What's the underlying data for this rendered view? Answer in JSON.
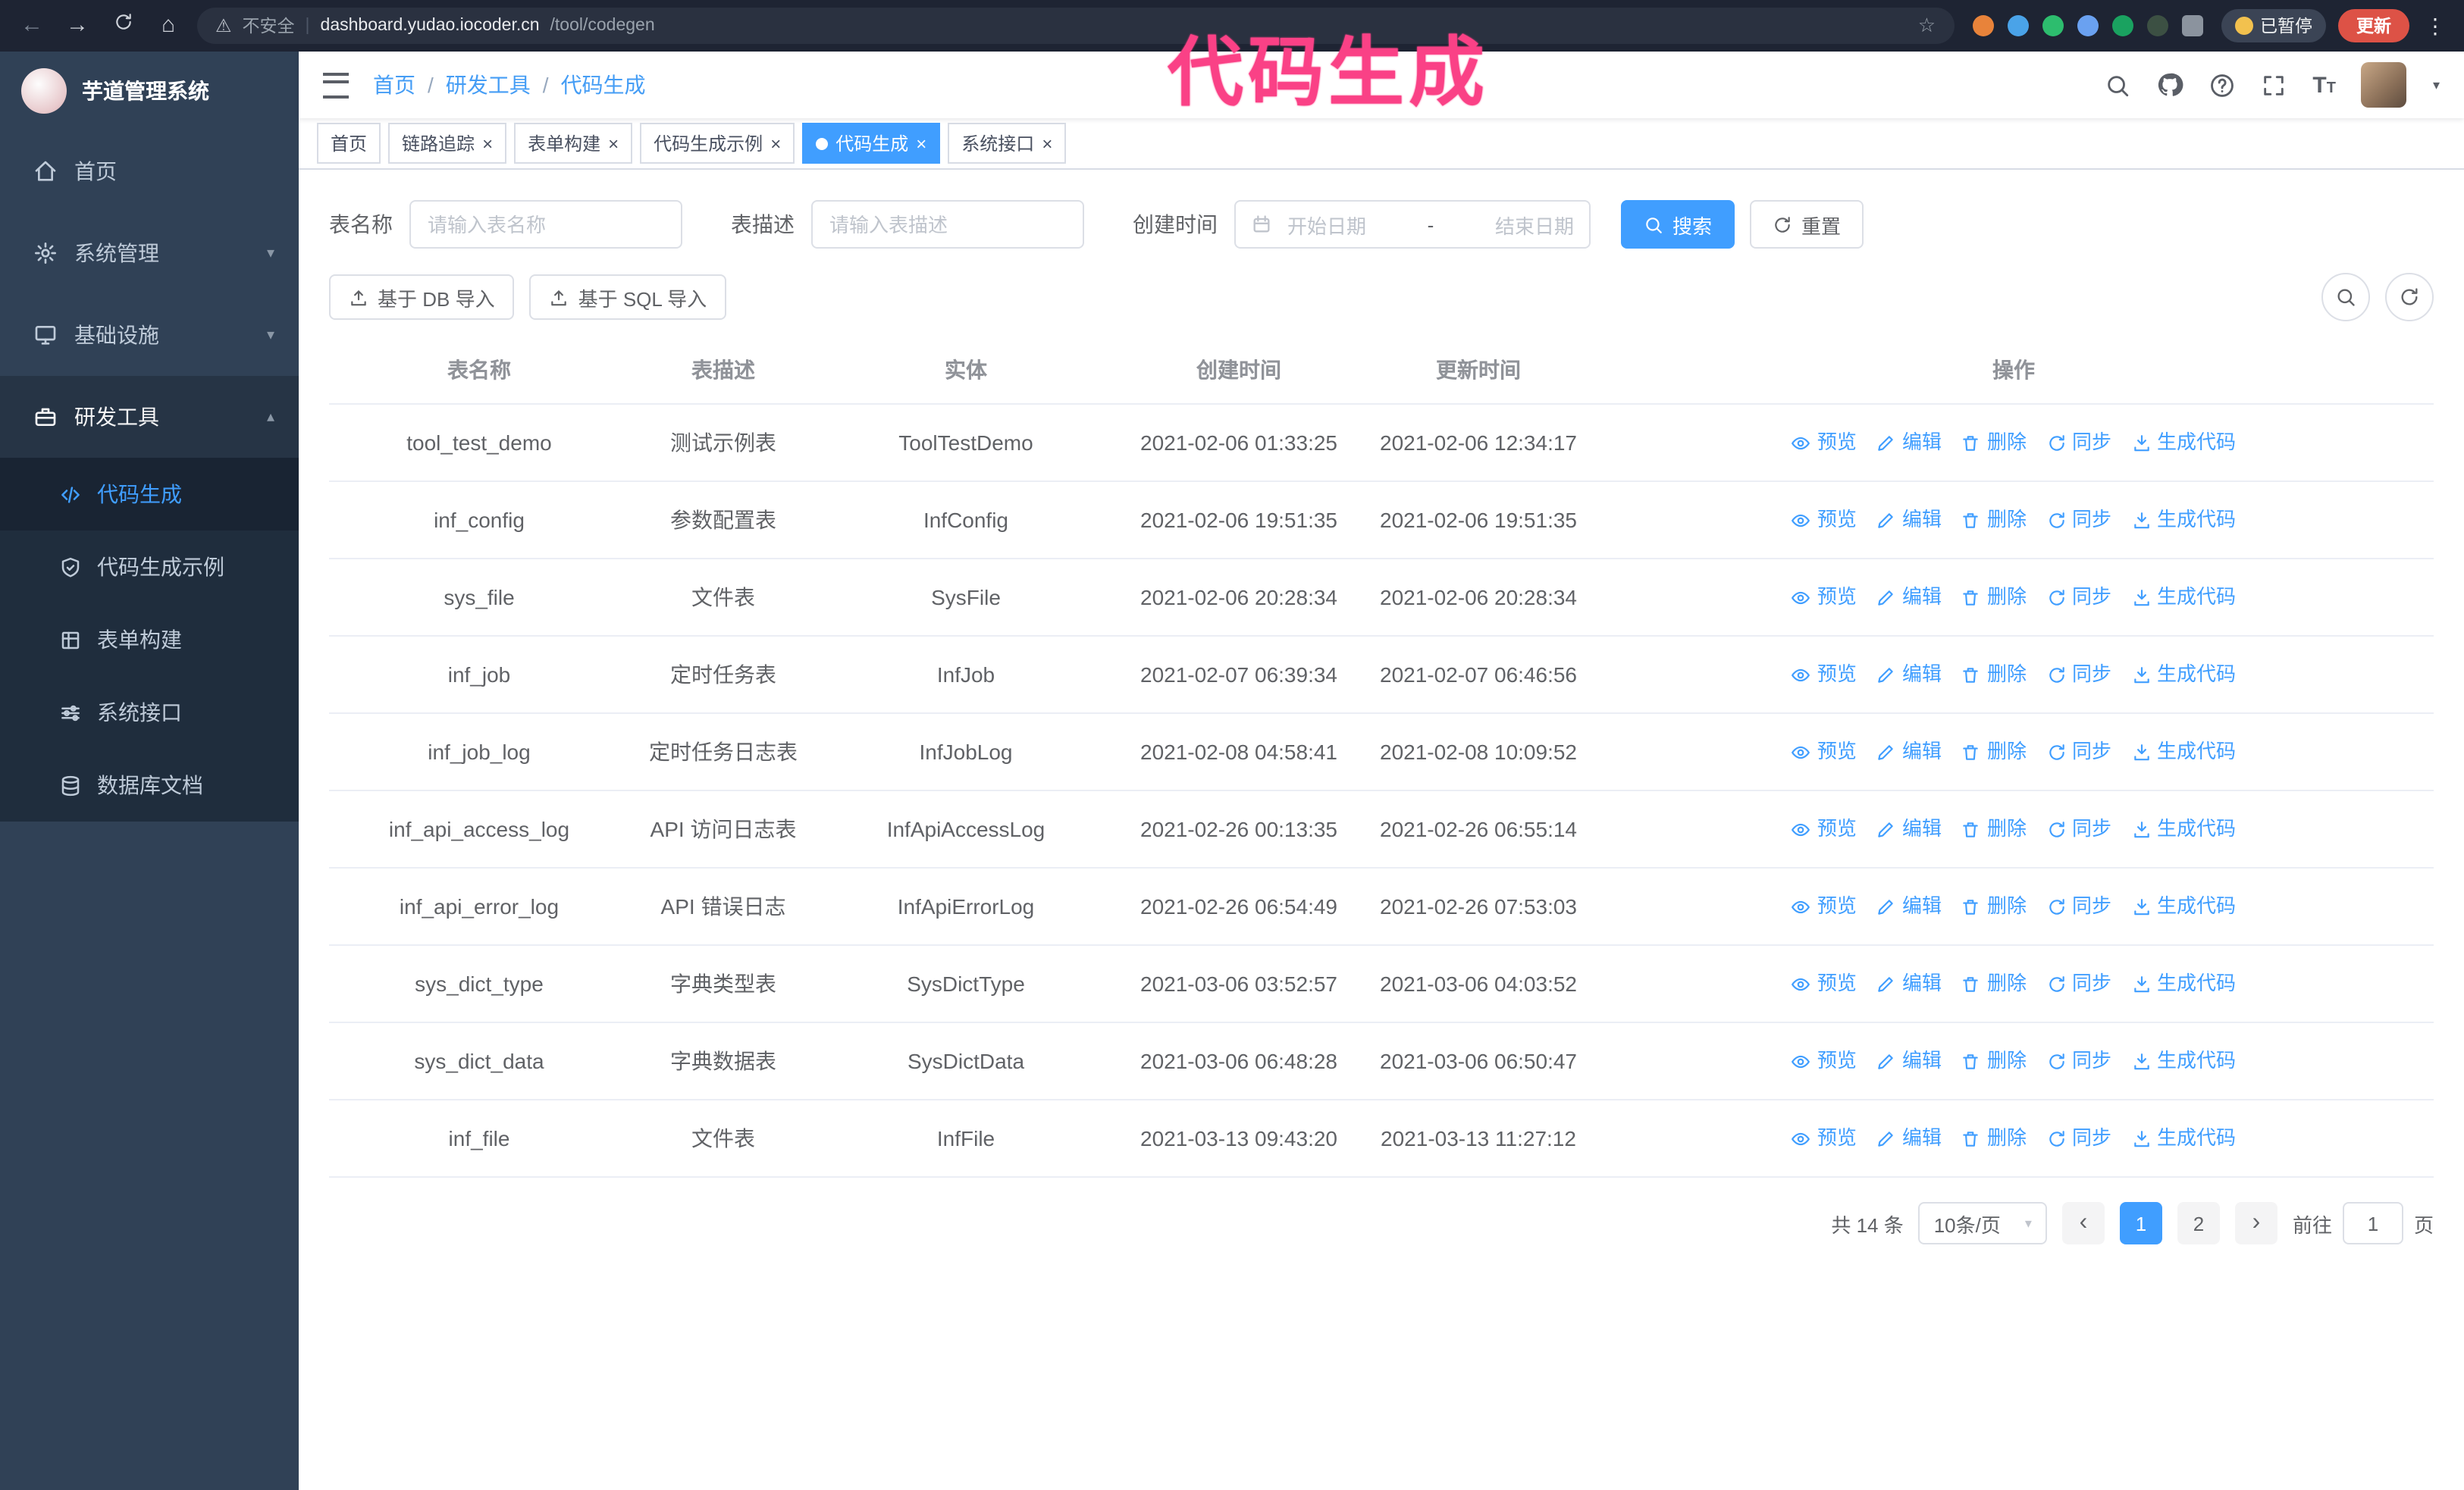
{
  "annotation": {
    "text": "代码生成"
  },
  "colors": {
    "accent": "#409eff",
    "sidebar_bg": "#304156",
    "annotation_pink": "#fa4186",
    "update_button_red": "#dd5246"
  },
  "browser": {
    "security_label": "不安全",
    "url_host": "dashboard.yudao.iocoder.cn",
    "url_path": "/tool/codegen",
    "paused_badge": "已暂停",
    "update_button": "更新"
  },
  "sidebar": {
    "logo_title": "芋道管理系统",
    "items": [
      {
        "label": "首页"
      },
      {
        "label": "系统管理"
      },
      {
        "label": "基础设施"
      },
      {
        "label": "研发工具"
      }
    ],
    "subitems": [
      {
        "label": "代码生成"
      },
      {
        "label": "代码生成示例"
      },
      {
        "label": "表单构建"
      },
      {
        "label": "系统接口"
      },
      {
        "label": "数据库文档"
      }
    ]
  },
  "header": {
    "breadcrumb": [
      "首页",
      "研发工具",
      "代码生成"
    ]
  },
  "tabs": [
    {
      "label": "首页"
    },
    {
      "label": "链路追踪"
    },
    {
      "label": "表单构建"
    },
    {
      "label": "代码生成示例"
    },
    {
      "label": "代码生成"
    },
    {
      "label": "系统接口"
    }
  ],
  "filters": {
    "table_name_label": "表名称",
    "table_name_placeholder": "请输入表名称",
    "table_desc_label": "表描述",
    "table_desc_placeholder": "请输入表描述",
    "create_time_label": "创建时间",
    "date_start_placeholder": "开始日期",
    "date_separator": "-",
    "date_end_placeholder": "结束日期",
    "search_button": "搜索",
    "reset_button": "重置"
  },
  "toolbar": {
    "import_db": "基于 DB 导入",
    "import_sql": "基于 SQL 导入"
  },
  "table": {
    "columns": [
      "表名称",
      "表描述",
      "实体",
      "创建时间",
      "更新时间",
      "操作"
    ],
    "actions": [
      "预览",
      "编辑",
      "删除",
      "同步",
      "生成代码"
    ],
    "rows": [
      {
        "name": "tool_test_demo",
        "desc": "测试示例表",
        "entity": "ToolTestDemo",
        "created": "2021-02-06 01:33:25",
        "updated": "2021-02-06 12:34:17"
      },
      {
        "name": "inf_config",
        "desc": "参数配置表",
        "entity": "InfConfig",
        "created": "2021-02-06 19:51:35",
        "updated": "2021-02-06 19:51:35"
      },
      {
        "name": "sys_file",
        "desc": "文件表",
        "entity": "SysFile",
        "created": "2021-02-06 20:28:34",
        "updated": "2021-02-06 20:28:34"
      },
      {
        "name": "inf_job",
        "desc": "定时任务表",
        "entity": "InfJob",
        "created": "2021-02-07 06:39:34",
        "updated": "2021-02-07 06:46:56"
      },
      {
        "name": "inf_job_log",
        "desc": "定时任务日志表",
        "entity": "InfJobLog",
        "created": "2021-02-08 04:58:41",
        "updated": "2021-02-08 10:09:52"
      },
      {
        "name": "inf_api_access_log",
        "desc": "API 访问日志表",
        "entity": "InfApiAccessLog",
        "created": "2021-02-26 00:13:35",
        "updated": "2021-02-26 06:55:14"
      },
      {
        "name": "inf_api_error_log",
        "desc": "API 错误日志",
        "entity": "InfApiErrorLog",
        "created": "2021-02-26 06:54:49",
        "updated": "2021-02-26 07:53:03"
      },
      {
        "name": "sys_dict_type",
        "desc": "字典类型表",
        "entity": "SysDictType",
        "created": "2021-03-06 03:52:57",
        "updated": "2021-03-06 04:03:52"
      },
      {
        "name": "sys_dict_data",
        "desc": "字典数据表",
        "entity": "SysDictData",
        "created": "2021-03-06 06:48:28",
        "updated": "2021-03-06 06:50:47"
      },
      {
        "name": "inf_file",
        "desc": "文件表",
        "entity": "InfFile",
        "created": "2021-03-13 09:43:20",
        "updated": "2021-03-13 11:27:12"
      }
    ]
  },
  "pagination": {
    "total": "共 14 条",
    "page_size": "10条/页",
    "pages": [
      "1",
      "2"
    ],
    "goto_prefix": "前往",
    "goto_value": "1",
    "goto_suffix": "页"
  }
}
